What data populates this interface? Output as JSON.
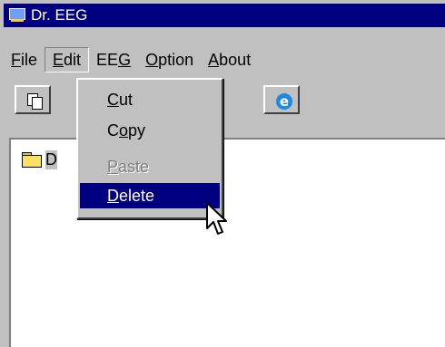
{
  "window": {
    "title": "Dr. EEG"
  },
  "menubar": {
    "items": [
      {
        "label": "File",
        "mnemonic": "F",
        "rest": "ile"
      },
      {
        "label": "Edit",
        "mnemonic": "E",
        "rest": "dit"
      },
      {
        "label": "EEG",
        "prefix": "EE",
        "mnemonic": "G"
      },
      {
        "label": "Option",
        "mnemonic": "O",
        "rest": "ption"
      },
      {
        "label": "About",
        "mnemonic": "A",
        "rest": "bout"
      }
    ],
    "active": "Edit"
  },
  "toolbar": {
    "buttons": [
      {
        "icon": "copy-icon"
      },
      {
        "icon": "internet-explorer-icon",
        "glyph": "e"
      }
    ]
  },
  "edit_menu": {
    "items": [
      {
        "label": "Cut",
        "mnemonic": "C",
        "rest": "ut",
        "state": "enabled"
      },
      {
        "label": "Copy",
        "prefix": "C",
        "mnemonic": "o",
        "rest": "py",
        "state": "enabled"
      },
      {
        "label": "Paste",
        "mnemonic": "P",
        "rest": "aste",
        "state": "disabled"
      },
      {
        "label": "Delete",
        "mnemonic": "D",
        "rest": "elete",
        "state": "selected"
      }
    ]
  },
  "tree": {
    "node_label": "D",
    "icon": "folder-open-icon"
  },
  "colors": {
    "titlebar": "#000080",
    "face": "#c0c0c0",
    "highlight": "#000080",
    "disabled_text": "#808080"
  }
}
